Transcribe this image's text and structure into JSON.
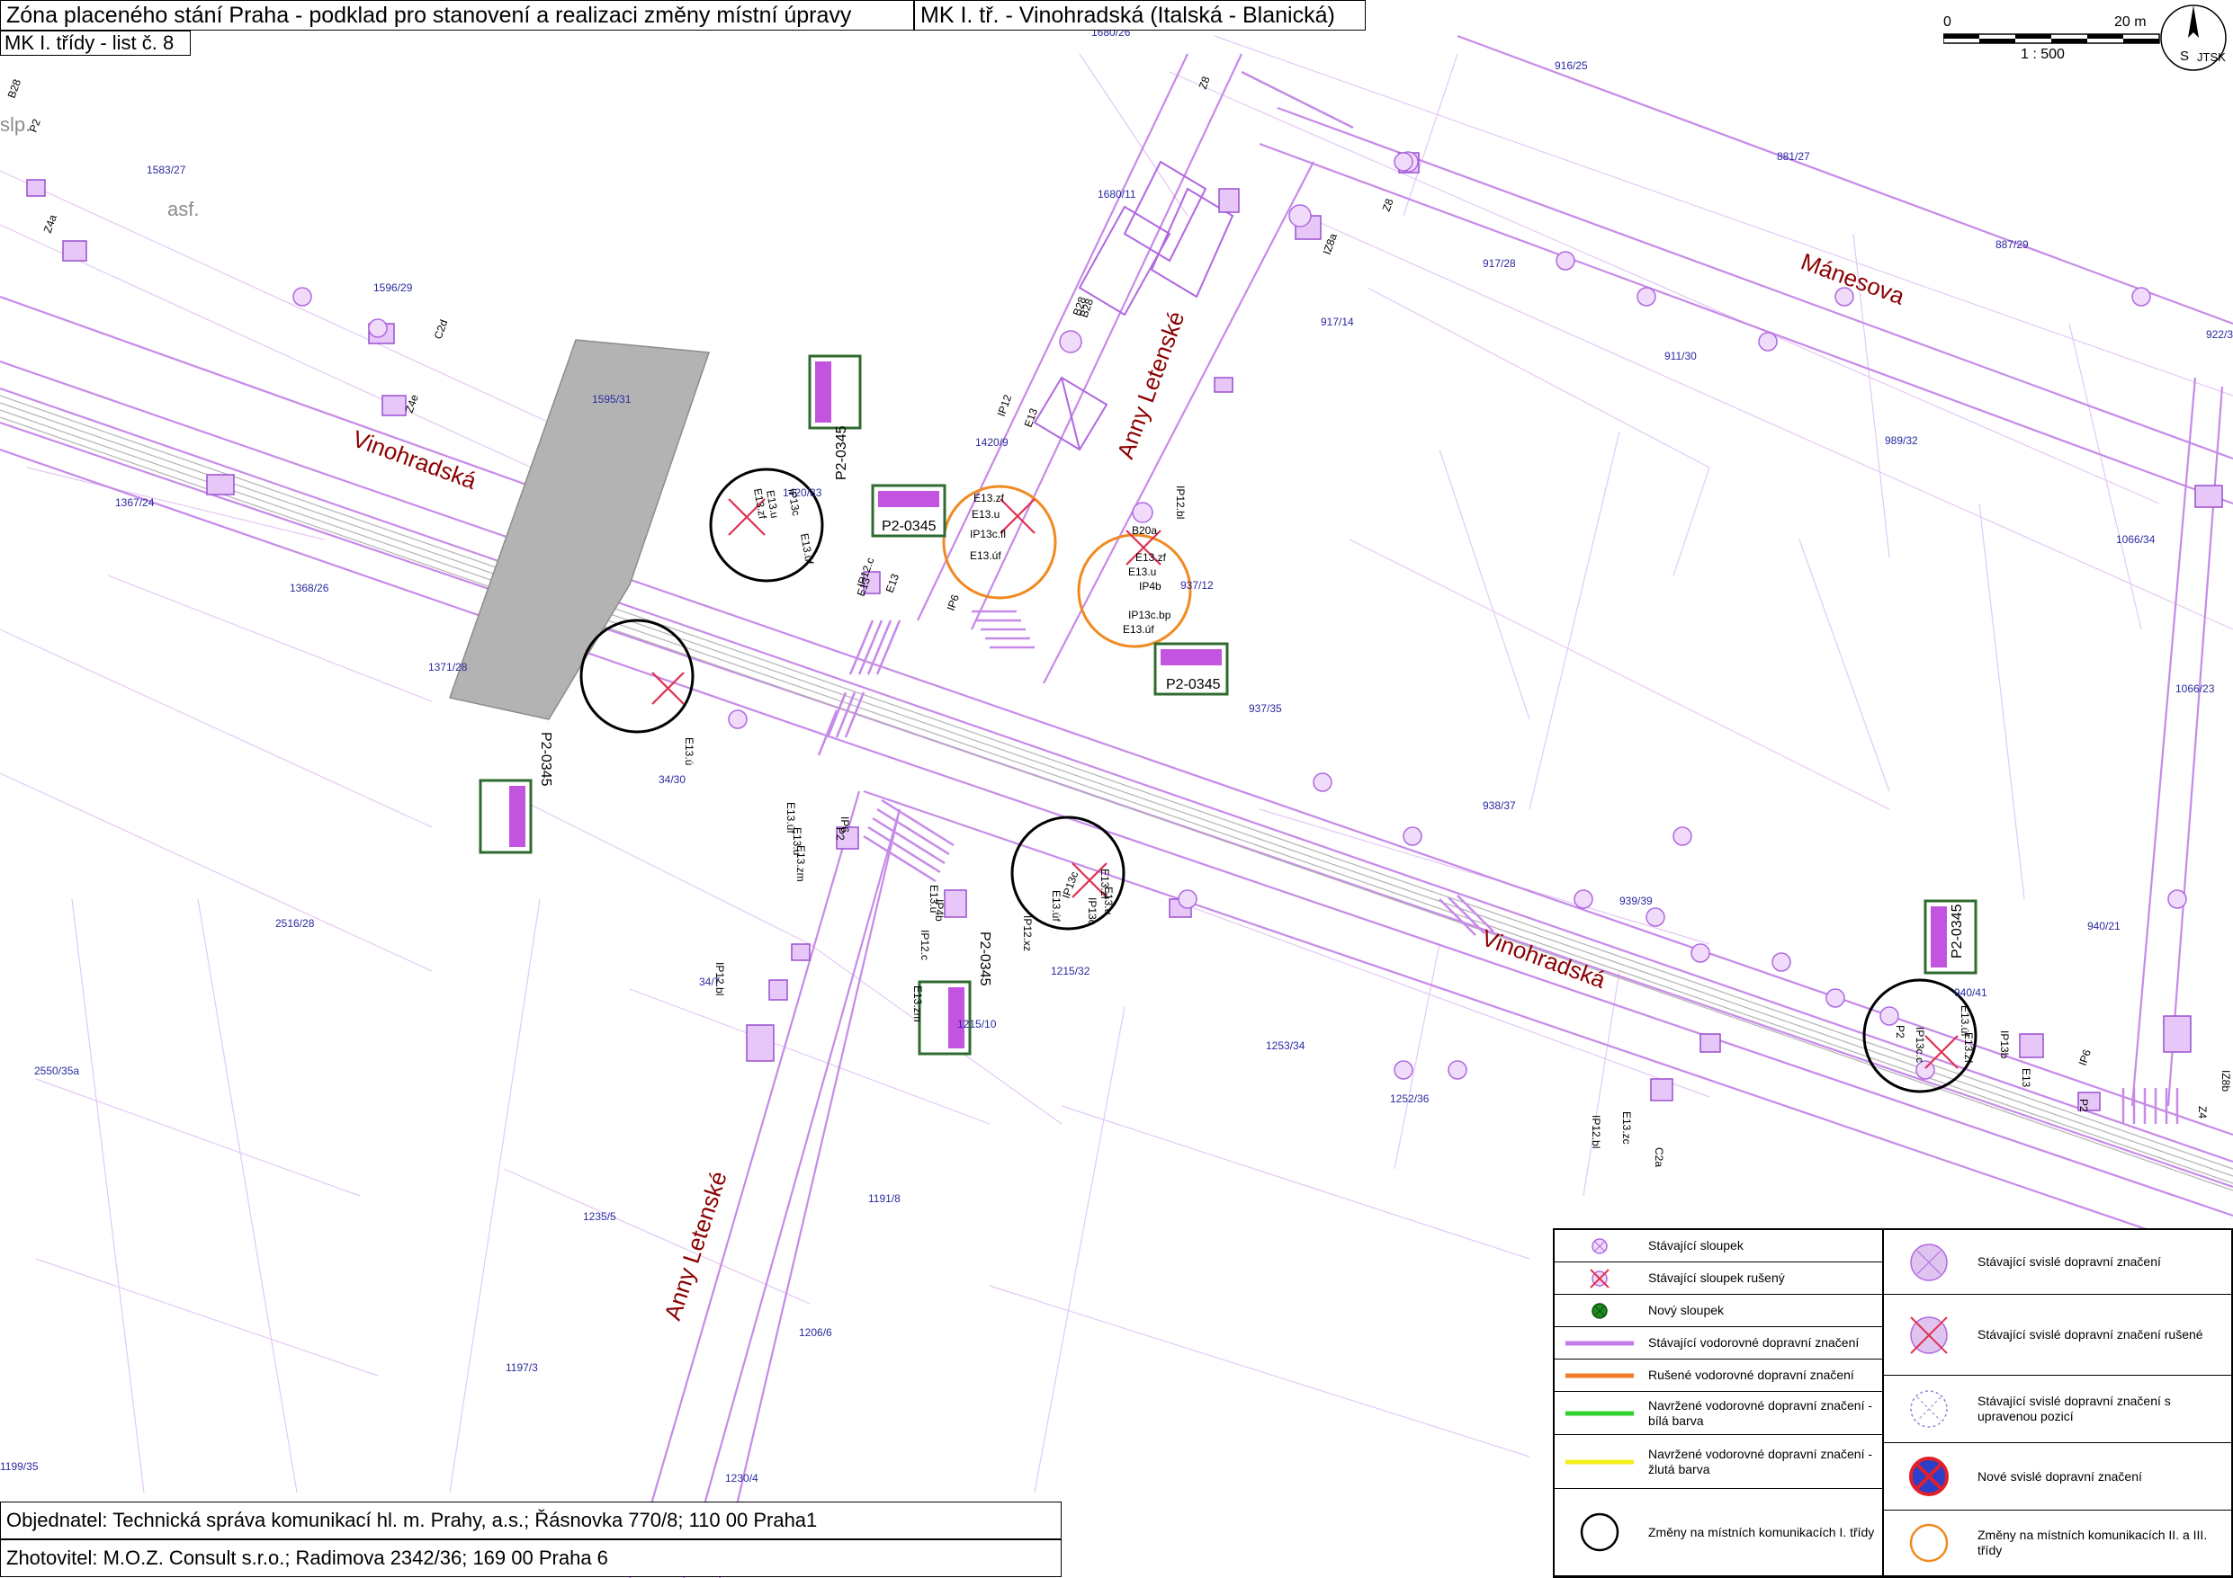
{
  "title": {
    "main": "Zóna placeného stání Praha - podklad pro stanovení a realizaci změny místní úpravy",
    "location": "MK I. tř. - Vinohradská (Italská - Blanická)",
    "sheet": "MK I. třídy - list č. 8"
  },
  "scale": {
    "zero": "0",
    "length": "20 m",
    "ratio": "1 : 500"
  },
  "north": {
    "letter": "S",
    "system": "JTSK"
  },
  "streets": {
    "vinohradska": "Vinohradská",
    "anny_letenske": "Anny Letenské",
    "manesova": "Mánesova"
  },
  "surface_labels": {
    "slp": "slp.",
    "asf": "asf."
  },
  "parcels": [
    "1680/26",
    "916/25",
    "1583/27",
    "881/27",
    "1680/11",
    "887/29",
    "917/28",
    "1596/29",
    "917/14",
    "922/3",
    "911/30",
    "1595/31",
    "1420/9",
    "989/32",
    "1367/24",
    "1420/33",
    "1066/34",
    "1368/26",
    "937/12",
    "937/35",
    "1371/28",
    "1066/23",
    "34/30",
    "938/37",
    "939/39",
    "2516/28",
    "940/21",
    "34/7",
    "1215/32",
    "940/41",
    "1215/10",
    "1253/34",
    "2550/35a",
    "1252/36",
    "1235/5",
    "1191/8",
    "1206/6",
    "1197/3",
    "1199/35",
    "1230/4"
  ],
  "sign_codes": [
    "B28",
    "P2",
    "Z4e",
    "C2d",
    "Z4a",
    "B28",
    "Z8",
    "Z8",
    "IZ8a",
    "E13",
    "IP12",
    "E13",
    "B28",
    "IP12.bl",
    "B20a",
    "E13.zf",
    "E13.u",
    "IP4b",
    "IP13c.bp",
    "E13.úf",
    "E13.zf",
    "E13.u",
    "IP13c.fl",
    "E13.úf",
    "E13.zf",
    "E13.u",
    "IP13c",
    "E13.úf",
    "IP12.c",
    "E13",
    "IP6",
    "IP13c",
    "E13.ú",
    "E13.úf",
    "P2",
    "IP6",
    "E13.u",
    "E13.zm",
    "IP12.c",
    "IP4b",
    "E13.u",
    "E13.zm",
    "IP12.bl",
    "IP12.xz",
    "E13.úf",
    "IP13c",
    "E13.u",
    "E13.zf",
    "IP12.bl",
    "E13.zc",
    "C2a",
    "P2",
    "IP13c.c",
    "E13.úf",
    "E13.zf",
    "IP13b",
    "E13",
    "IP6",
    "P2",
    "IZ8b",
    "Z4"
  ],
  "zone_sign": "P2-0345",
  "legend": {
    "left": [
      {
        "text": "Stávající sloupek",
        "icon": "existing-post-icon"
      },
      {
        "text": "Stávající sloupek rušený",
        "icon": "cancelled-post-icon"
      },
      {
        "text": "Nový sloupek",
        "icon": "new-post-icon"
      },
      {
        "text": "Stávající vodorovné dopravní značení",
        "icon": "purple-line-icon",
        "color": "#c27ce8"
      },
      {
        "text": "Rušené vodorovné dopravní značení",
        "icon": "orange-line-icon",
        "color": "#f07a28"
      },
      {
        "text": "Navržené vodorovné dopravní značení - bílá barva",
        "icon": "green-line-icon",
        "color": "#2fd12f"
      },
      {
        "text": "Navržené vodorovné dopravní značení - žlutá barva",
        "icon": "yellow-line-icon",
        "color": "#f2ee1a"
      },
      {
        "text": "Změny na místních komunikacích I. třídy",
        "icon": "black-circle-icon"
      }
    ],
    "right": [
      {
        "text": "Stávající svislé dopravní značení",
        "icon": "existing-sign-icon"
      },
      {
        "text": "Stávající svislé dopravní značení rušené",
        "icon": "cancelled-sign-icon"
      },
      {
        "text": "Stávající svislé dopravní značení s upravenou pozicí",
        "icon": "moved-sign-icon"
      },
      {
        "text": "Nové svislé dopravní značení",
        "icon": "new-sign-icon"
      },
      {
        "text": "Změny na místních komunikacích II. a III. třídy",
        "icon": "orange-circle-icon"
      }
    ]
  },
  "footer": {
    "client": "Objednatel: Technická správa komunikací hl. m. Prahy, a.s.; Řásnovka 770/8; 110 00 Praha1",
    "contractor": "Zhotovitel: M.O.Z. Consult s.r.o.; Radimova 2342/36; 169 00 Praha 6"
  },
  "colors": {
    "survey_lines": "#d9a3f2",
    "marking_lines": "#b86ee0",
    "parcel_text": "#2a2aa0",
    "street_text": "#8b0000",
    "building_block": "#b3b3b3",
    "change_circle_class1": "#000000",
    "change_circle_class2": "#f08a20"
  }
}
